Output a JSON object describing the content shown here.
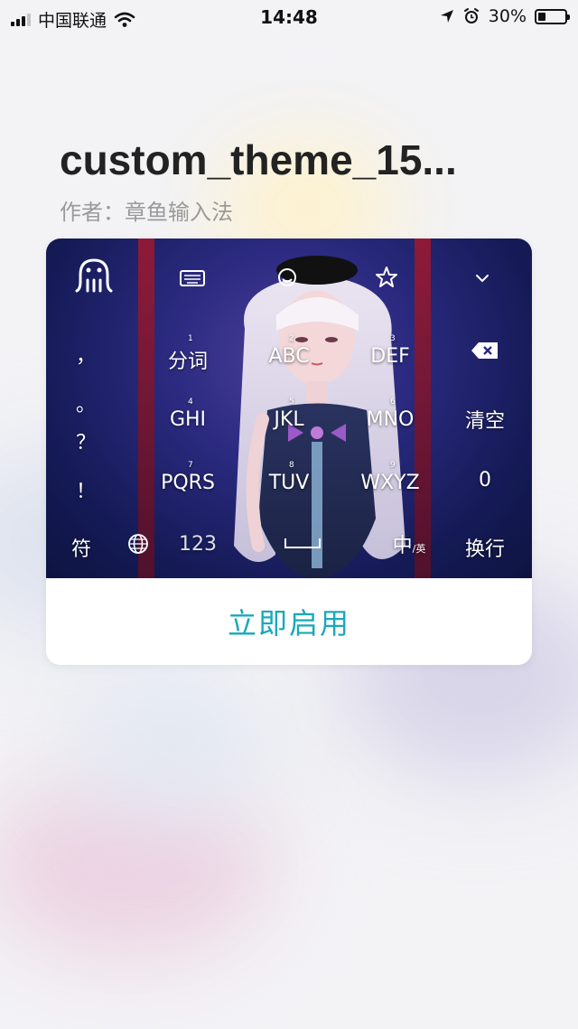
{
  "status_bar": {
    "carrier": "中国联通",
    "time": "14:48",
    "battery_percent": "30%",
    "battery_level": 0.3
  },
  "theme": {
    "name": "custom_theme_15...",
    "author": "作者：章鱼输入法"
  },
  "keyboard_preview": {
    "row_keys": [
      "分词",
      "ABC",
      "DEF",
      "GHI",
      "JKL",
      "MNO",
      "PQRS",
      "TUV",
      "WXYZ"
    ],
    "key_numbers": [
      "1",
      "2",
      "3",
      "4",
      "5",
      "6",
      "7",
      "8",
      "9"
    ],
    "punctuation": [
      "，",
      "。",
      "？",
      "！"
    ],
    "right_keys": [
      "清空",
      "0",
      "换行"
    ],
    "bottom_keys": {
      "symbol": "符",
      "numbers": "123",
      "lang_main": "中",
      "lang_sub": "/英"
    },
    "icons": [
      "octopus-logo-icon",
      "keyboard-icon",
      "emoji-icon",
      "star-icon",
      "chevron-down-icon",
      "backspace-icon",
      "globe-icon",
      "space-icon"
    ]
  },
  "apply_button": "立即启用",
  "colors": {
    "accent": "#1aa9b9",
    "title": "#222222",
    "subtitle": "#9a9a9a"
  }
}
